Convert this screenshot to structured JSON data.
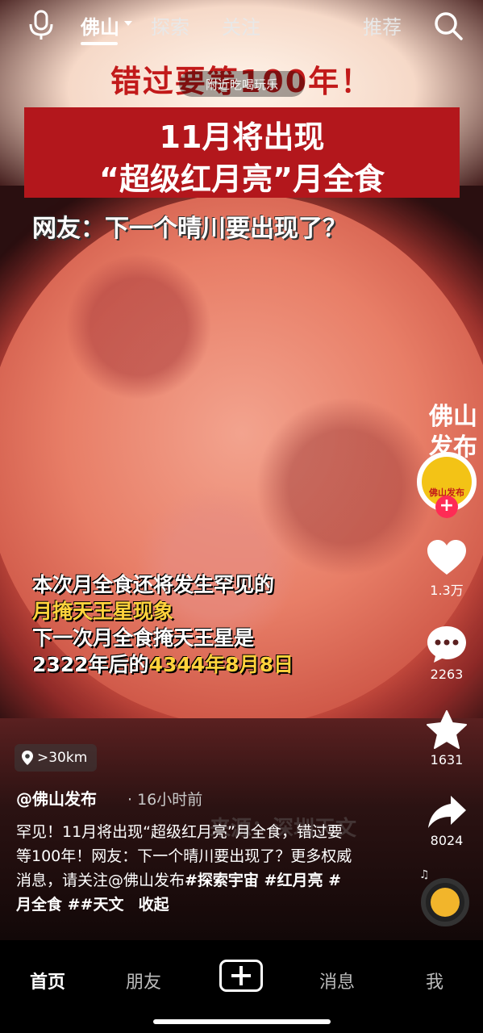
{
  "topbar": {
    "tabs": [
      {
        "label": "佛山",
        "active": true
      },
      {
        "label": "探索",
        "active": false
      },
      {
        "label": "关注",
        "active": false
      },
      {
        "label": "推荐",
        "active": false
      }
    ]
  },
  "video": {
    "headline_top": "错过要等100年！",
    "nearby_pill": "附近吃喝玩乐",
    "banner_line1": "11月将出现",
    "banner_line2": "“超级红月亮”月全食",
    "subhead": "网友：下一个晴川要出现了？",
    "caption_line1": "本次月全食还将发生罕见的",
    "caption_line2": "月掩天王星现象",
    "caption_line3": "下一次月全食掩天王星是",
    "caption_line4a": "2322年后的",
    "caption_line4b": "4344年8月8日",
    "watermark": "佛山发布"
  },
  "rail": {
    "avatar_text": "佛山发布",
    "likes": "1.3万",
    "comments": "2263",
    "favorites": "1631",
    "shares": "8024",
    "like_icon_color": "#ffffff"
  },
  "post": {
    "location": ">30km",
    "author": "@佛山发布",
    "time": "· 16小时前",
    "desc_text": "罕见！11月将出现“超级红月亮”月全食，错过要等100年！网友：下一个晴川要出现了？更多权威消息，请关注@佛山发布",
    "hashtags": "#探索宇宙  #红月亮 #月全食 ##天文",
    "collapse": "收起",
    "bg_watermark": "来源：深圳天文"
  },
  "bottomnav": {
    "items": [
      {
        "label": "首页",
        "active": true
      },
      {
        "label": "朋友",
        "active": false
      },
      {
        "label": "消息",
        "active": false
      },
      {
        "label": "我",
        "active": false
      }
    ]
  },
  "colors": {
    "accent": "#fe2c55",
    "banner_red": "#b3171c",
    "caption_yellow": "#ffd23c"
  }
}
